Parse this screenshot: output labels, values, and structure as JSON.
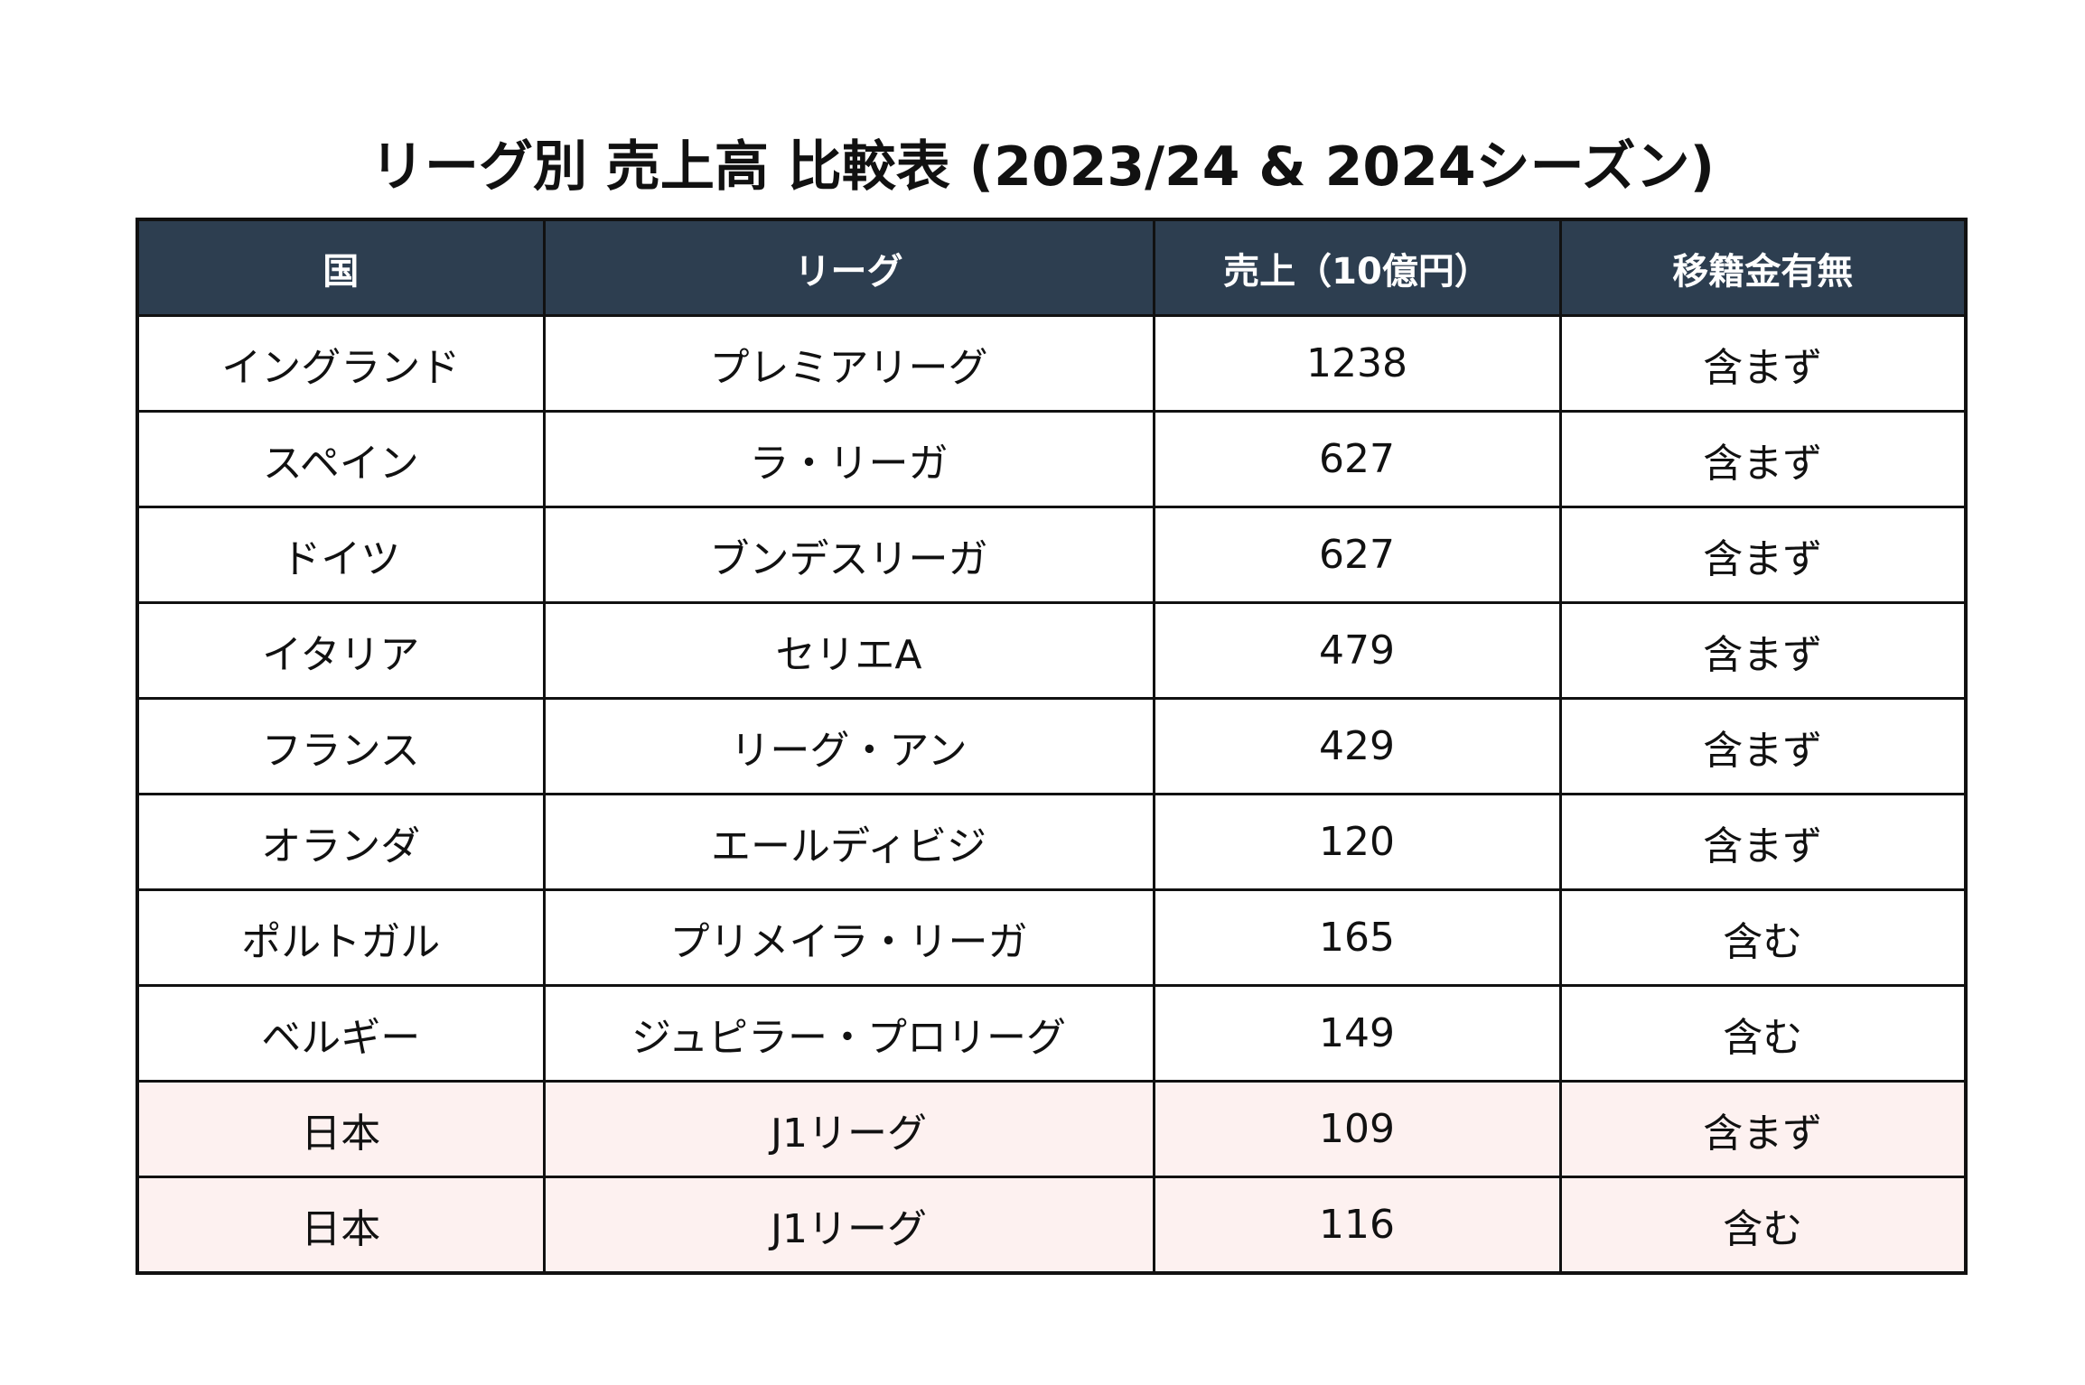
{
  "title": "リーグ別 売上高 比較表 (2023/24 & 2024シーズン)",
  "colors": {
    "header_bg": "#2d3e50",
    "header_text": "#ffffff",
    "row_bg": "#ffffff",
    "highlight_bg": "#fdf1f0",
    "border": "#111111"
  },
  "table": {
    "headers": [
      "国",
      "リーグ",
      "売上（10億円）",
      "移籍金有無"
    ],
    "rows": [
      {
        "country": "イングランド",
        "league": "プレミアリーグ",
        "sales": "1238",
        "transfer": "含まず",
        "highlight": false
      },
      {
        "country": "スペイン",
        "league": "ラ・リーガ",
        "sales": "627",
        "transfer": "含まず",
        "highlight": false
      },
      {
        "country": "ドイツ",
        "league": "ブンデスリーガ",
        "sales": "627",
        "transfer": "含まず",
        "highlight": false
      },
      {
        "country": "イタリア",
        "league": "セリエA",
        "sales": "479",
        "transfer": "含まず",
        "highlight": false
      },
      {
        "country": "フランス",
        "league": "リーグ・アン",
        "sales": "429",
        "transfer": "含まず",
        "highlight": false
      },
      {
        "country": "オランダ",
        "league": "エールディビジ",
        "sales": "120",
        "transfer": "含まず",
        "highlight": false
      },
      {
        "country": "ポルトガル",
        "league": "プリメイラ・リーガ",
        "sales": "165",
        "transfer": "含む",
        "highlight": false
      },
      {
        "country": "ベルギー",
        "league": "ジュピラー・プロリーグ",
        "sales": "149",
        "transfer": "含む",
        "highlight": false
      },
      {
        "country": "日本",
        "league": "J1リーグ",
        "sales": "109",
        "transfer": "含まず",
        "highlight": true
      },
      {
        "country": "日本",
        "league": "J1リーグ",
        "sales": "116",
        "transfer": "含む",
        "highlight": true
      }
    ]
  }
}
